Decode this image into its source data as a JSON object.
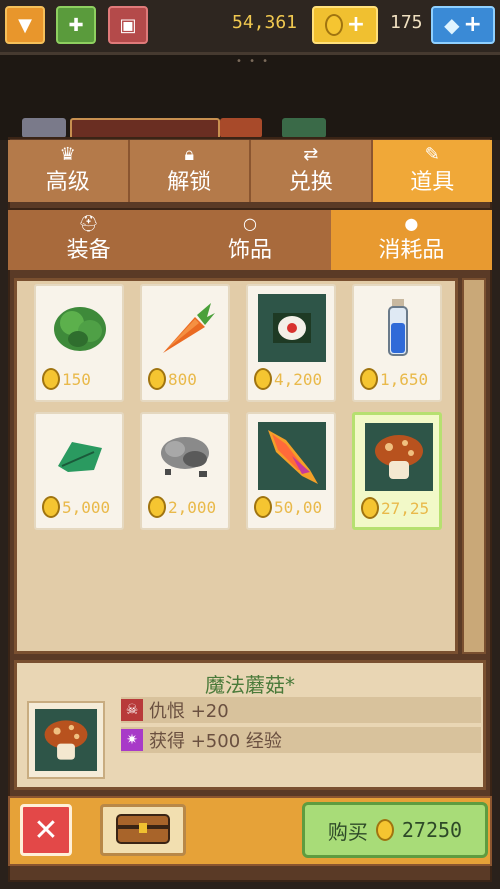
{
  "topbar": {
    "gold_amount": "54,361",
    "gem_amount": "175",
    "plus": "+"
  },
  "tabs": [
    {
      "label": "高级",
      "icon": "crown-icon"
    },
    {
      "label": "解锁",
      "icon": "lock-icon"
    },
    {
      "label": "兑换",
      "icon": "exchange-icon"
    },
    {
      "label": "道具",
      "icon": "item-icon",
      "active": true
    }
  ],
  "subtabs": [
    {
      "label": "装备",
      "icon": "helmet-icon"
    },
    {
      "label": "饰品",
      "icon": "ring-icon"
    },
    {
      "label": "消耗品",
      "icon": "potion-icon",
      "active": true
    }
  ],
  "items": [
    {
      "name": "lettuce",
      "price": "150"
    },
    {
      "name": "carrot",
      "price": "800"
    },
    {
      "name": "sushi-roll",
      "price": "4,200"
    },
    {
      "name": "blue-potion",
      "price": "1,650"
    },
    {
      "name": "green-leaf",
      "price": "5,000"
    },
    {
      "name": "ore-pile",
      "price": "2,000"
    },
    {
      "name": "phoenix-feather",
      "price": "50,00"
    },
    {
      "name": "magic-mushroom",
      "price": "27,25",
      "selected": true
    }
  ],
  "detail": {
    "title": "魔法蘑菇*",
    "stat1": "仇恨  +20",
    "stat2": "获得  +500  经验"
  },
  "buy": {
    "label": "购买",
    "price": "27250"
  },
  "colors": {
    "tab_active": "#f0a838",
    "gold_text": "#e9b94a",
    "buy_button": "#a8dc78"
  }
}
